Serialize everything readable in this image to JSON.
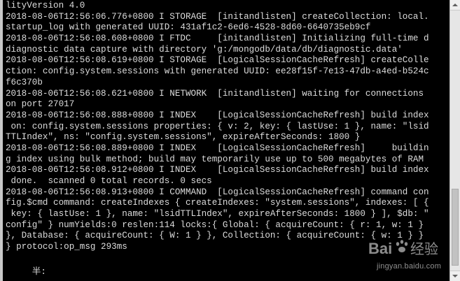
{
  "console": {
    "lines": [
      "lityVersion 4.0",
      "2018-08-06T12:56:06.776+0800 I STORAGE  [initandlisten] createCollection: local.",
      "startup_log with generated UUID: 431af1c2-6ed6-4528-8d60-6640735eb9cf",
      "2018-08-06T12:56:08.608+0800 I FTDC     [initandlisten] Initializing full-time d",
      "diagnostic data capture with directory 'g:/mongodb/data/db/diagnostic.data'",
      "2018-08-06T12:56:08.619+0800 I STORAGE  [LogicalSessionCacheRefresh] createColle",
      "ction: config.system.sessions with generated UUID: ee28f15f-7e13-47db-a4ed-b524c",
      "f6c370b",
      "2018-08-06T12:56:08.621+0800 I NETWORK  [initandlisten] waiting for connections",
      "on port 27017",
      "2018-08-06T12:56:08.888+0800 I INDEX    [LogicalSessionCacheRefresh] build index",
      " on: config.system.sessions properties: { v: 2, key: { lastUse: 1 }, name: \"lsid",
      "TTLIndex\", ns: \"config.system.sessions\", expireAfterSeconds: 1800 }",
      "2018-08-06T12:56:08.889+0800 I INDEX    [LogicalSessionCacheRefresh]     buildin",
      "g index using bulk method; build may temporarily use up to 500 megabytes of RAM",
      "2018-08-06T12:56:08.912+0800 I INDEX    [LogicalSessionCacheRefresh] build index",
      " done.  scanned 0 total records. 0 secs",
      "2018-08-06T12:56:08.913+0800 I COMMAND  [LogicalSessionCacheRefresh] command con",
      "fig.$cmd command: createIndexes { createIndexes: \"system.sessions\", indexes: [ {",
      " key: { lastUse: 1 }, name: \"lsidTTLIndex\", expireAfterSeconds: 1800 } ], $db: \"",
      "config\" } numYields:0 reslen:114 locks:{ Global: { acquireCount: { r: 1, w: 1 }",
      "}, Database: { acquireCount: { W: 1 } }, Collection: { acquireCount: { w: 1 } }",
      "} protocol:op_msg 293ms"
    ],
    "ime_indicator": "     半:"
  },
  "watermark": {
    "brand": "Bai 经验",
    "url": "jingyan.baidu.com"
  },
  "colors": {
    "background": "#000000",
    "text": "#dcdcdc",
    "scrollbar": "#e6e6e6"
  }
}
